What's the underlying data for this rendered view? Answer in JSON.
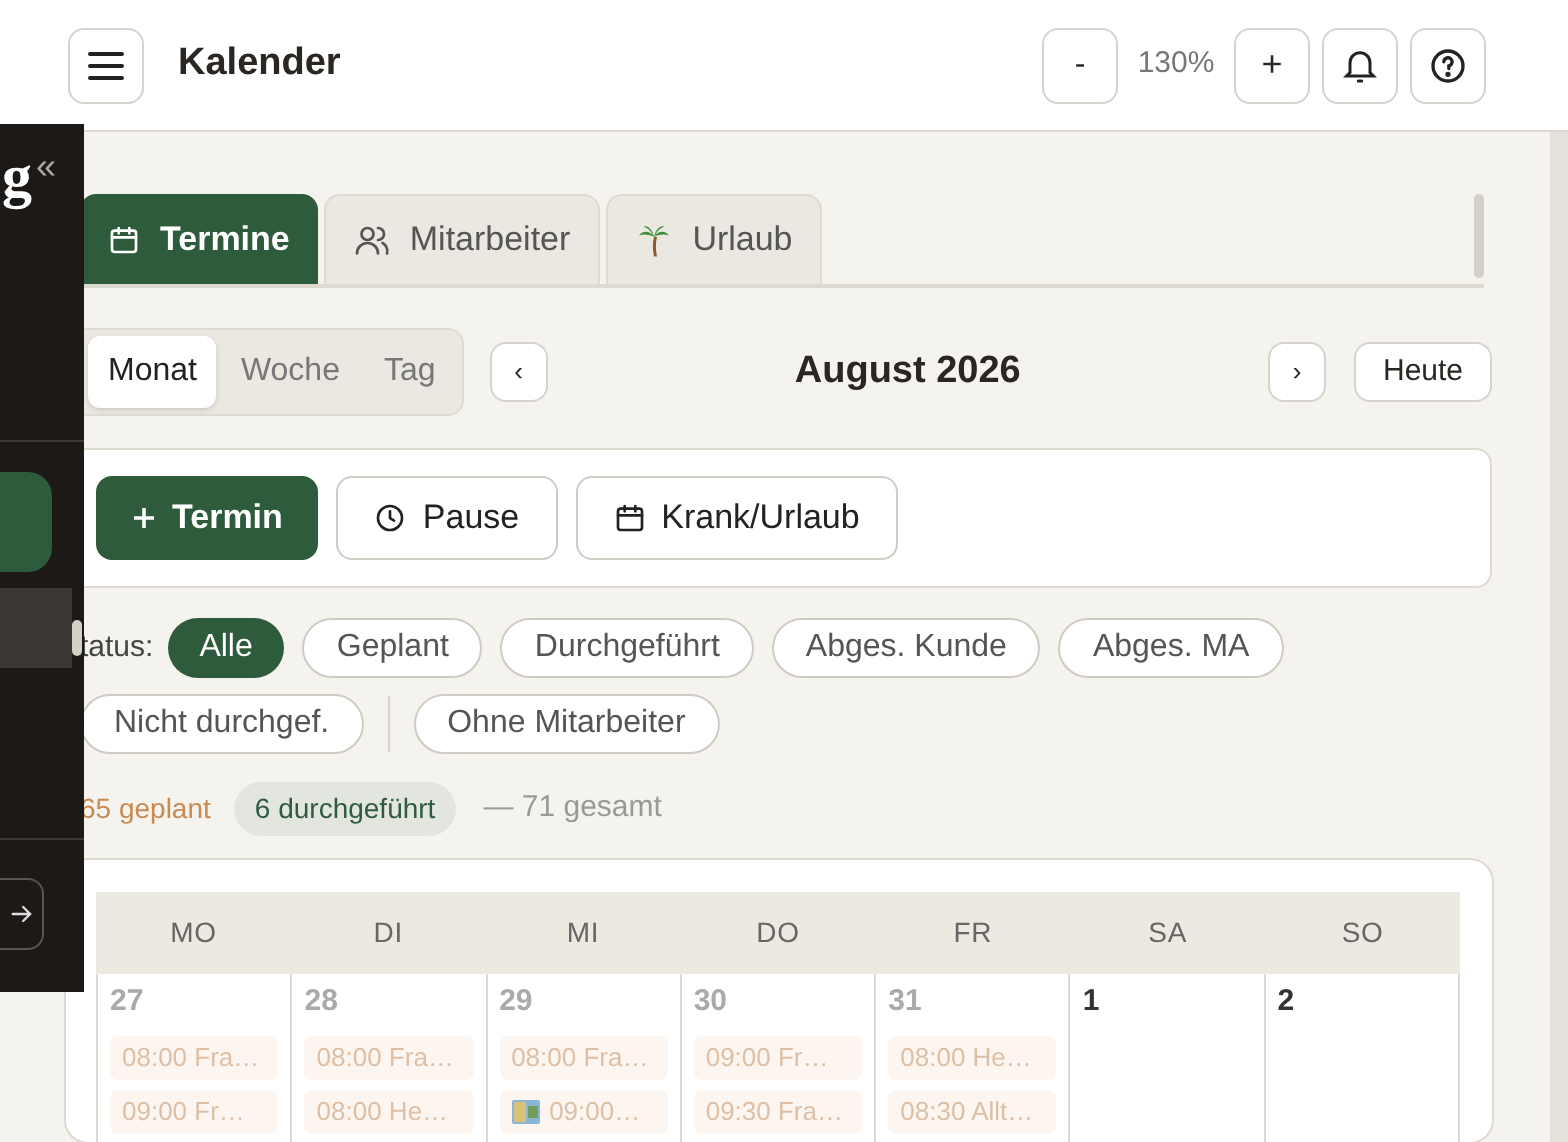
{
  "header": {
    "title": "Kalender",
    "zoom_out": "-",
    "zoom": "130%",
    "zoom_in": "+"
  },
  "sidebar": {
    "logo": "g",
    "collapse": "«"
  },
  "tabs": [
    {
      "label": "Termine",
      "kind": "calendar",
      "selected": true
    },
    {
      "label": "Mitarbeiter",
      "kind": "people",
      "selected": false
    },
    {
      "label": "Urlaub",
      "kind": "palm",
      "selected": false
    }
  ],
  "views": [
    {
      "label": "Monat",
      "selected": true
    },
    {
      "label": "Woche",
      "selected": false
    },
    {
      "label": "Tag",
      "selected": false
    }
  ],
  "nav": {
    "prev": "‹",
    "title": "August 2026",
    "next": "›",
    "today": "Heute"
  },
  "actions": [
    {
      "label": "Termin",
      "kind": "primary"
    },
    {
      "label": "Pause",
      "kind": "clock"
    },
    {
      "label": "Krank/Urlaub",
      "kind": "calendar"
    }
  ],
  "status_label": "tatus:",
  "status_filters": [
    {
      "label": "Alle",
      "selected": true
    },
    {
      "label": "Geplant",
      "selected": false
    },
    {
      "label": "Durchgeführt",
      "selected": false
    },
    {
      "label": "Abges. Kunde",
      "selected": false
    },
    {
      "label": "Abges. MA",
      "selected": false
    },
    {
      "label": "Nicht durchgef.",
      "selected": false
    }
  ],
  "staff_filter": {
    "label": "Ohne Mitarbeiter",
    "selected": false
  },
  "summary": {
    "planned": "65 geplant",
    "done": "6 durchgeführt",
    "total": "— 71 gesamt"
  },
  "calendar": {
    "weekdays": [
      "MO",
      "DI",
      "MI",
      "DO",
      "FR",
      "SA",
      "SO"
    ],
    "days": [
      {
        "day": "27",
        "outside_month": true,
        "events": [
          {
            "text": "08:00 Fra…",
            "icon": false
          },
          {
            "text": "09:00 Fr…",
            "icon": false
          }
        ]
      },
      {
        "day": "28",
        "outside_month": true,
        "events": [
          {
            "text": "08:00 Fra…",
            "icon": false
          },
          {
            "text": "08:00 He…",
            "icon": false
          }
        ]
      },
      {
        "day": "29",
        "outside_month": true,
        "events": [
          {
            "text": "08:00 Fra…",
            "icon": false
          },
          {
            "text": "09:00…",
            "icon": true
          }
        ]
      },
      {
        "day": "30",
        "outside_month": true,
        "events": [
          {
            "text": "09:00 Fr…",
            "icon": false
          },
          {
            "text": "09:30 Fra…",
            "icon": false
          }
        ]
      },
      {
        "day": "31",
        "outside_month": true,
        "events": [
          {
            "text": "08:00 He…",
            "icon": false
          },
          {
            "text": "08:30 Allt…",
            "icon": false
          }
        ]
      },
      {
        "day": "1",
        "outside_month": false
      },
      {
        "day": "2",
        "outside_month": false
      }
    ]
  }
}
